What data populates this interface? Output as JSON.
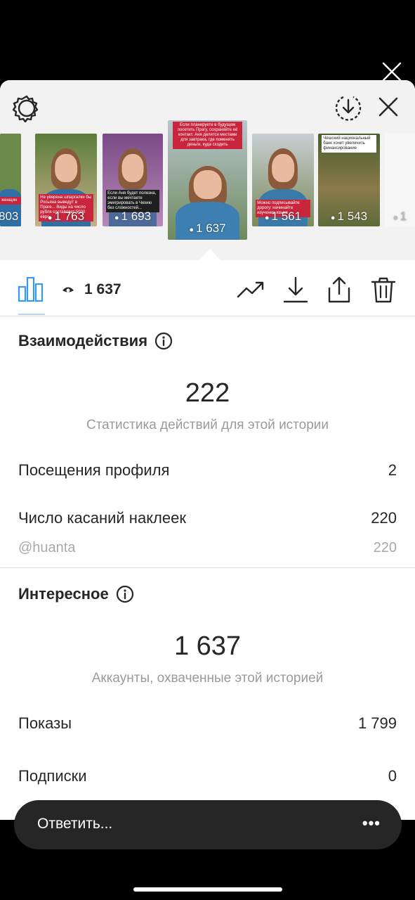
{
  "header": {
    "settings_icon": "gear-icon",
    "download_all_icon": "download-circle-icon",
    "close_icon": "close-icon"
  },
  "thumbnails": [
    {
      "views": "803",
      "caption": ""
    },
    {
      "views": "1 763",
      "caption": "Не уверена шпаргалки бы Росьяна выведут в Праге... Виды на число рубля составляет 5000 евро"
    },
    {
      "views": "1 693",
      "caption": "Если Аня будет полезна, если вы мечтаете эмигрировать в Чехию без сложностей..."
    },
    {
      "views": "1 637",
      "caption": "Если планируете в будущем посетить Прагу, сохраняйте её контакт. Аня делится местами для завтрака, где поменять деньги, куда сходить"
    },
    {
      "views": "1 561",
      "caption": "Можно подписывайте дорогу: начинайте изучение языка"
    },
    {
      "views": "1 543",
      "caption": "Чешский национальный банк хочет увеличить финансирование"
    },
    {
      "views": "1",
      "caption": ""
    }
  ],
  "tabbar": {
    "views": "1 637",
    "chart_icon": "bar-chart-icon",
    "eye_icon": "eye-icon",
    "trend_icon": "trending-up-icon",
    "download_icon": "download-icon",
    "share_icon": "share-icon",
    "delete_icon": "trash-icon"
  },
  "interactions": {
    "title": "Взаимодействия",
    "total": "222",
    "subtitle": "Статистика действий для этой истории",
    "rows": [
      {
        "label": "Посещения профиля",
        "value": "2"
      },
      {
        "label": "Число касаний наклеек",
        "value": "220"
      }
    ],
    "sub_row": {
      "label": "@huanta",
      "value": "220"
    }
  },
  "discovery": {
    "title": "Интересное",
    "total": "1 637",
    "subtitle": "Аккаунты, охваченные этой историей",
    "rows": [
      {
        "label": "Показы",
        "value": "1 799"
      },
      {
        "label": "Подписки",
        "value": "0"
      }
    ]
  },
  "reply": {
    "placeholder": "Ответить...",
    "more": "•••"
  },
  "colors": {
    "accent": "#3897f0",
    "caption_red": "#c9263d"
  }
}
